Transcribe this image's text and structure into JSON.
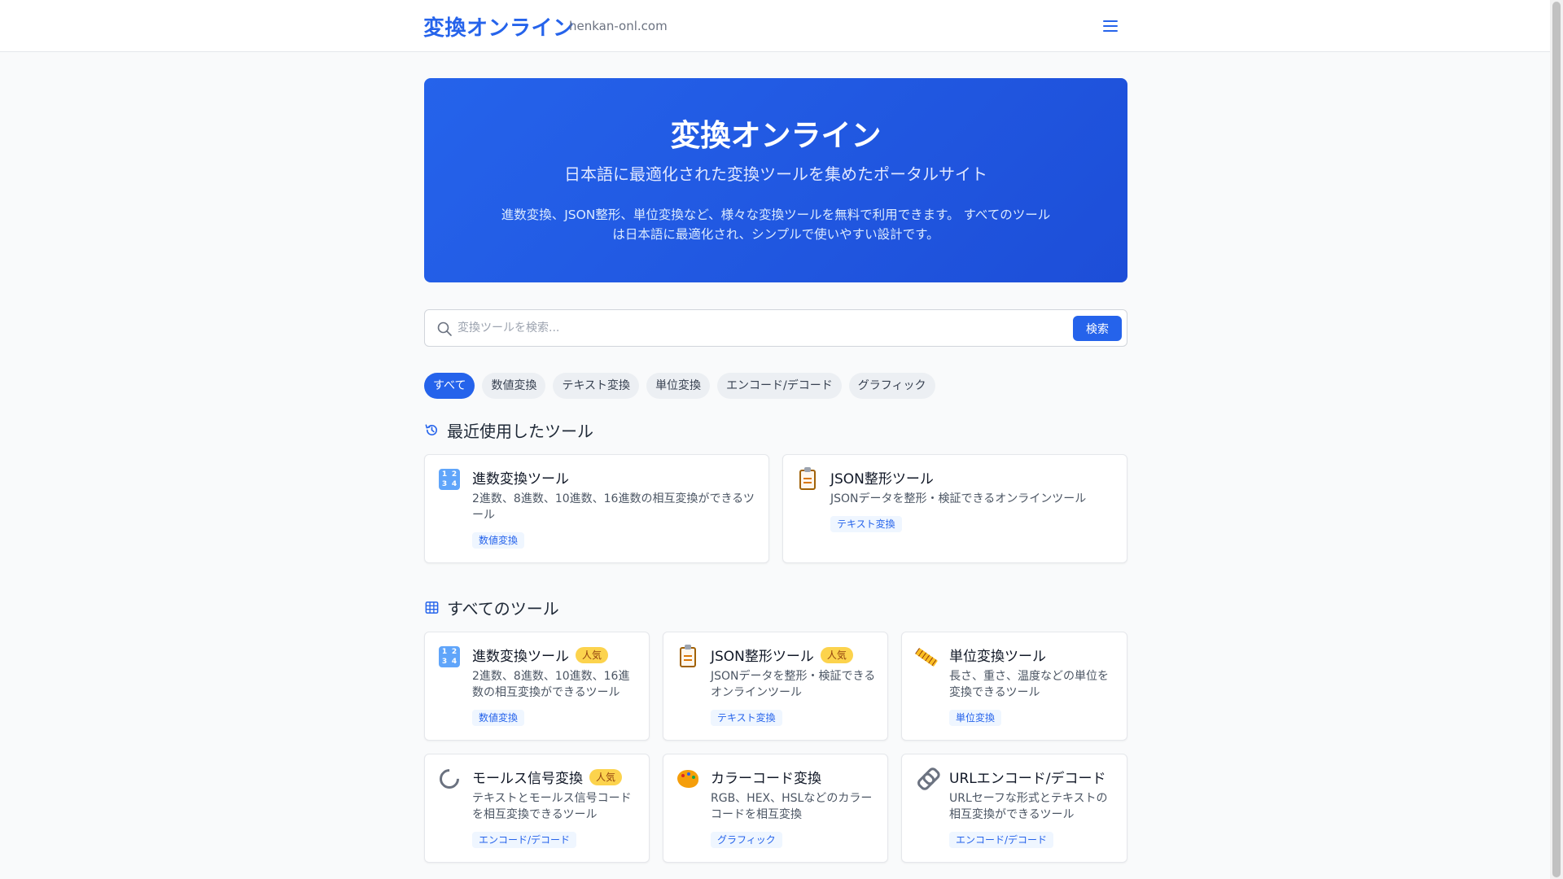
{
  "header": {
    "brand": "変換オンライン",
    "domain": "henkan-onl.com"
  },
  "hero": {
    "title": "変換オンライン",
    "subtitle": "日本語に最適化された変換ツールを集めたポータルサイト",
    "description": "進数変換、JSON整形、単位変換など、様々な変換ツールを無料で利用できます。 すべてのツールは日本語に最適化され、シンプルで使いやすい設計です。"
  },
  "search": {
    "placeholder": "変換ツールを検索...",
    "value": "",
    "button_label": "検索"
  },
  "filters": [
    {
      "label": "すべて",
      "active": true
    },
    {
      "label": "数値変換",
      "active": false
    },
    {
      "label": "テキスト変換",
      "active": false
    },
    {
      "label": "単位変換",
      "active": false
    },
    {
      "label": "エンコード/デコード",
      "active": false
    },
    {
      "label": "グラフィック",
      "active": false
    }
  ],
  "recent": {
    "heading": "最近使用したツール",
    "icon": "history-icon",
    "tools": [
      {
        "icon": "number-keypad-icon",
        "title": "進数変換ツール",
        "description": "2進数、8進数、10進数、16進数の相互変換ができるツール",
        "category": "数値変換"
      },
      {
        "icon": "clipboard-icon",
        "title": "JSON整形ツール",
        "description": "JSONデータを整形・検証できるオンラインツール",
        "category": "テキスト変換"
      }
    ]
  },
  "all": {
    "heading": "すべてのツール",
    "icon": "grid-icon",
    "tools": [
      {
        "icon": "number-keypad-icon",
        "title": "進数変換ツール",
        "badge": "人気",
        "description": "2進数、8進数、10進数、16進数の相互変換ができるツール",
        "category": "数値変換"
      },
      {
        "icon": "clipboard-icon",
        "title": "JSON整形ツール",
        "badge": "人気",
        "description": "JSONデータを整形・検証できるオンラインツール",
        "category": "テキスト変換"
      },
      {
        "icon": "ruler-icon",
        "title": "単位変換ツール",
        "badge": "",
        "description": "長さ、重さ、温度などの単位を変換できるツール",
        "category": "単位変換"
      },
      {
        "icon": "satellite-dish-icon",
        "title": "モールス信号変換",
        "badge": "人気",
        "description": "テキストとモールス信号コードを相互変換できるツール",
        "category": "エンコード/デコード"
      },
      {
        "icon": "palette-icon",
        "title": "カラーコード変換",
        "badge": "",
        "description": "RGB、HEX、HSLなどのカラーコードを相互変換",
        "category": "グラフィック"
      },
      {
        "icon": "link-icon",
        "title": "URLエンコード/デコード",
        "badge": "",
        "description": "URLセーフな形式とテキストの相互変換ができるツール",
        "category": "エンコード/デコード"
      }
    ]
  },
  "colors": {
    "accent": "#2563eb",
    "badge": "#fcd34d",
    "tag_bg": "#eff6ff"
  }
}
